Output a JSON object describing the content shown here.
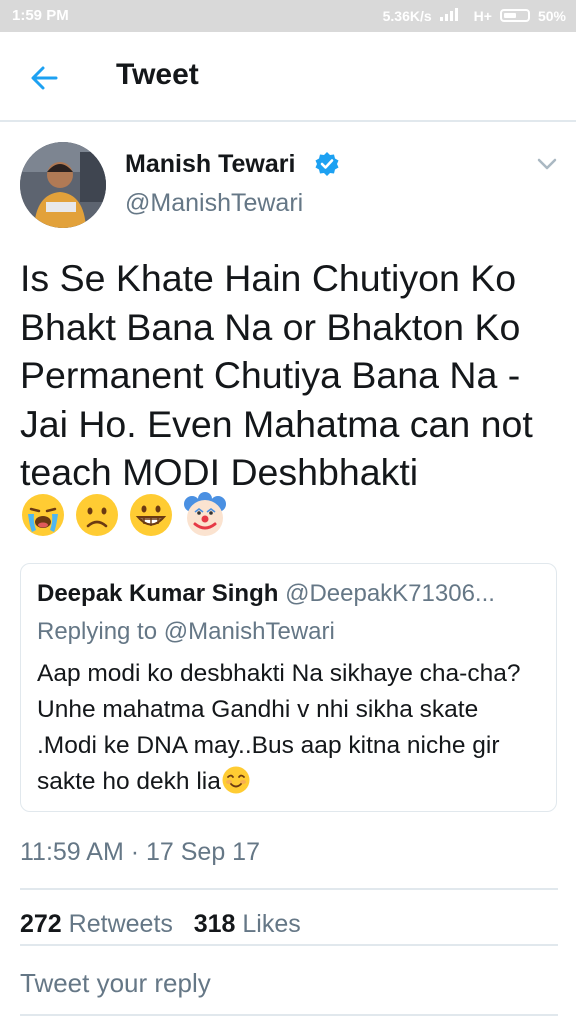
{
  "status_bar": {
    "time": "1:59 PM",
    "network_speed": "5.36K/s",
    "network_type": "H+",
    "battery": "50%"
  },
  "header": {
    "title": "Tweet",
    "back_icon": "arrow-left-icon"
  },
  "tweet": {
    "author": {
      "name": "Manish Tewari",
      "handle": "@ManishTewari",
      "verified": true
    },
    "text": "Is Se Khate Hain Chutiyon Ko Bhakt Bana Na or Bhakton Ko Permanent Chutiya Bana Na -Jai Ho. Even Mahatma can not teach MODI Deshbhakti",
    "emojis": [
      "loudly-crying-face",
      "frowning-face",
      "grinning-face",
      "clown-face"
    ],
    "timestamp": "11:59 AM · 17 Sep 17",
    "retweets_count": "272",
    "retweets_label": "Retweets",
    "likes_count": "318",
    "likes_label": "Likes"
  },
  "quoted_tweet": {
    "name": "Deepak Kumar Singh",
    "handle": "@DeepakK71306...",
    "replying_to": "Replying to @ManishTewari",
    "text": "Aap modi ko desbhakti Na sikhaye cha-cha? Unhe mahatma Gandhi v nhi sikha skate .Modi ke DNA may..Bus aap kitna niche gir sakte ho dekh lia",
    "emoji": "smiling-face"
  },
  "reply": {
    "placeholder": "Tweet your reply"
  },
  "colors": {
    "twitter_blue": "#1da1f2",
    "text_primary": "#14171a",
    "text_secondary": "#657786",
    "divider": "#e1e8ed",
    "status_bar": "#d9d9d9"
  }
}
